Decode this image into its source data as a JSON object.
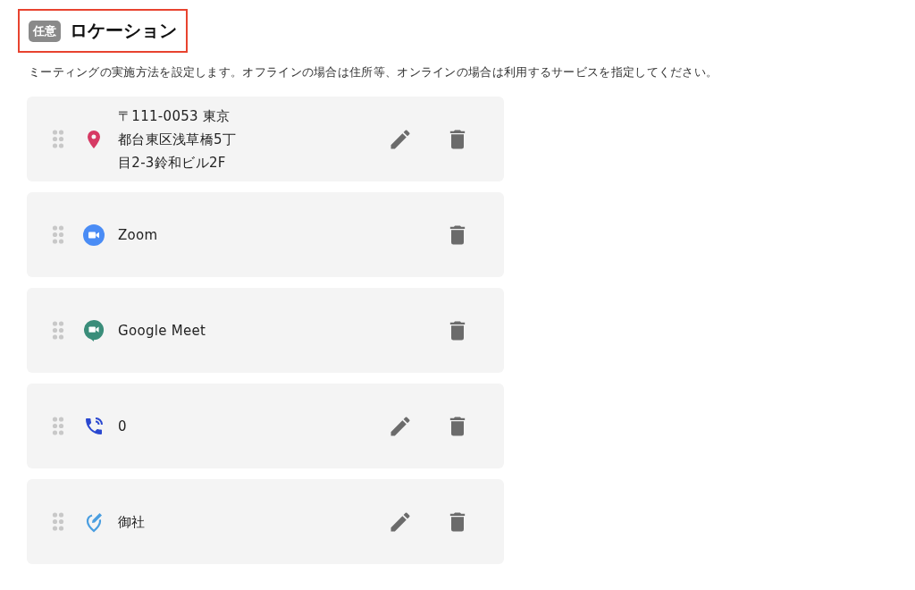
{
  "header": {
    "badge": "任意",
    "title": "ロケーション",
    "highlighted": true
  },
  "description": "ミーティングの実施方法を設定します。オフラインの場合は住所等、オンラインの場合は利用するサービスを指定してください。",
  "locations": [
    {
      "kind": "address",
      "label": "〒111-0053 東京都台東区浅草橋5丁目2-3鈴和ビル2F",
      "editable": true
    },
    {
      "kind": "zoom",
      "label": "Zoom",
      "editable": false
    },
    {
      "kind": "meet",
      "label": "Google Meet",
      "editable": false
    },
    {
      "kind": "phone",
      "label": "0",
      "editable": true
    },
    {
      "kind": "custom",
      "label": "御社",
      "editable": true
    }
  ]
}
